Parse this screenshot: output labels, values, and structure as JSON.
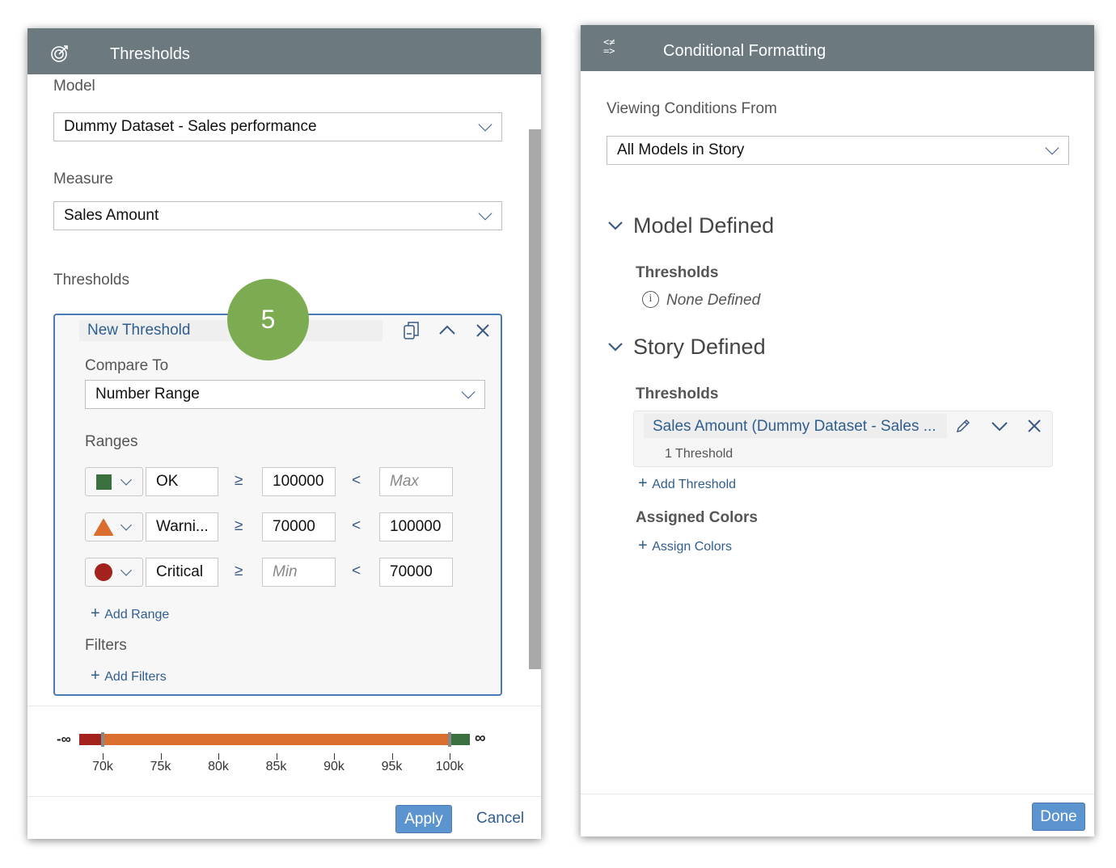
{
  "thresholds_panel": {
    "title": "Thresholds",
    "header_icon": "target-icon",
    "model_label": "Model",
    "model_value": "Dummy Dataset - Sales performance",
    "measure_label": "Measure",
    "measure_value": "Sales Amount",
    "thresholds_label": "Thresholds",
    "step_badge": "5",
    "threshold_card": {
      "name": "New Threshold",
      "compare_to_label": "Compare To",
      "compare_to_value": "Number Range",
      "ranges_label": "Ranges",
      "ranges": [
        {
          "symbol": "square",
          "color": "#3a7040",
          "label": "OK",
          "op1": "≥",
          "from": "100000",
          "from_placeholder": "",
          "op2": "<",
          "to": "",
          "to_placeholder": "Max"
        },
        {
          "symbol": "triangle",
          "color": "#d96e2e",
          "label": "Warni...",
          "op1": "≥",
          "from": "70000",
          "from_placeholder": "",
          "op2": "<",
          "to": "100000",
          "to_placeholder": ""
        },
        {
          "symbol": "circle",
          "color": "#a3221d",
          "label": "Critical",
          "op1": "≥",
          "from": "",
          "from_placeholder": "Min",
          "op2": "<",
          "to": "70000",
          "to_placeholder": ""
        }
      ],
      "add_range": "Add Range",
      "filters_label": "Filters",
      "add_filters": "Add Filters"
    },
    "range_bar": {
      "neg_inf": "-∞",
      "pos_inf": "∞",
      "ticks": [
        "70k",
        "75k",
        "80k",
        "85k",
        "90k",
        "95k",
        "100k"
      ],
      "tick_values": [
        70000,
        75000,
        80000,
        85000,
        90000,
        95000,
        100000
      ],
      "segments": [
        {
          "color": "#a3221d"
        },
        {
          "color": "#d96e2e"
        },
        {
          "color": "#3a7040"
        }
      ]
    },
    "apply": "Apply",
    "cancel": "Cancel"
  },
  "cf_panel": {
    "title": "Conditional Formatting",
    "header_icon": "conditions-icon",
    "viewing_label": "Viewing Conditions From",
    "viewing_value": "All Models in Story",
    "model_defined": "Model Defined",
    "model_thresholds_label": "Thresholds",
    "none_defined": "None Defined",
    "story_defined": "Story Defined",
    "story_thresholds_label": "Thresholds",
    "threshold_item": {
      "title": "Sales Amount (Dummy Dataset - Sales ...",
      "count": "1 Threshold"
    },
    "add_threshold": "Add Threshold",
    "assigned_colors": "Assigned Colors",
    "assign_colors": "Assign Colors",
    "done": "Done"
  }
}
